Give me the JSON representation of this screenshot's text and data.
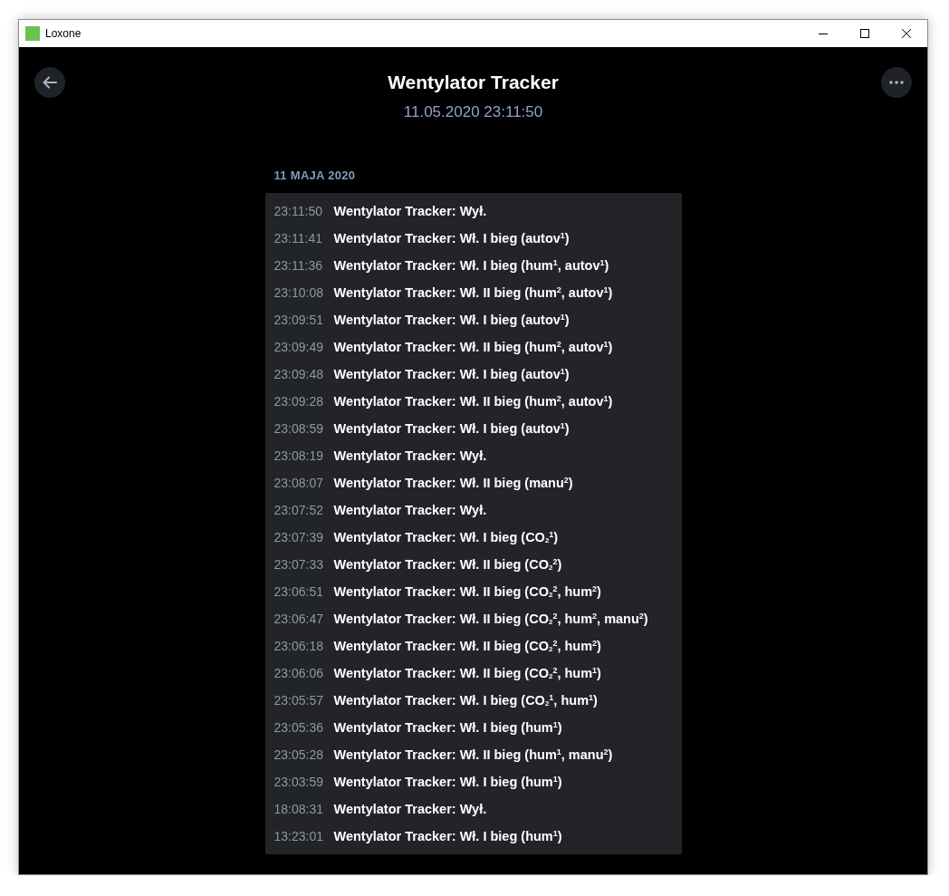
{
  "window": {
    "title": "Loxone"
  },
  "header": {
    "title": "Wentylator Tracker",
    "subtitle": "11.05.2020 23:11:50"
  },
  "date_label": "11 MAJA 2020",
  "entries": [
    {
      "time": "23:11:50",
      "text": "Wentylator Tracker: Wył."
    },
    {
      "time": "23:11:41",
      "text": "Wentylator Tracker: Wł. I bieg (autov$^{1}$)"
    },
    {
      "time": "23:11:36",
      "text": "Wentylator Tracker: Wł. I bieg (hum$^{1}$, autov$^{1}$)"
    },
    {
      "time": "23:10:08",
      "text": "Wentylator Tracker: Wł. II bieg (hum$^{2}$, autov$^{1}$)"
    },
    {
      "time": "23:09:51",
      "text": "Wentylator Tracker: Wł. I bieg (autov$^{1}$)"
    },
    {
      "time": "23:09:49",
      "text": "Wentylator Tracker: Wł. II bieg (hum$^{2}$, autov$^{1}$)"
    },
    {
      "time": "23:09:48",
      "text": "Wentylator Tracker: Wł. I bieg (autov$^{1}$)"
    },
    {
      "time": "23:09:28",
      "text": "Wentylator Tracker: Wł. II bieg (hum$^{2}$, autov$^{1}$)"
    },
    {
      "time": "23:08:59",
      "text": "Wentylator Tracker: Wł. I bieg (autov$^{1}$)"
    },
    {
      "time": "23:08:19",
      "text": "Wentylator Tracker: Wył."
    },
    {
      "time": "23:08:07",
      "text": "Wentylator Tracker: Wł. II bieg (manu$^{2}$)"
    },
    {
      "time": "23:07:52",
      "text": "Wentylator Tracker: Wył."
    },
    {
      "time": "23:07:39",
      "text": "Wentylator Tracker: Wł. I bieg (CO$_{2}$$^{1}$)"
    },
    {
      "time": "23:07:33",
      "text": "Wentylator Tracker: Wł. II bieg (CO$_{2}$$^{2}$)"
    },
    {
      "time": "23:06:51",
      "text": "Wentylator Tracker: Wł. II bieg (CO$_{2}$$^{2}$, hum$^{2}$)"
    },
    {
      "time": "23:06:47",
      "text": "Wentylator Tracker: Wł. II bieg (CO$_{2}$$^{2}$, hum$^{2}$, manu$^{2}$)"
    },
    {
      "time": "23:06:18",
      "text": "Wentylator Tracker: Wł. II bieg (CO$_{2}$$^{2}$, hum$^{2}$)"
    },
    {
      "time": "23:06:06",
      "text": "Wentylator Tracker: Wł. II bieg (CO$_{2}$$^{2}$, hum$^{1}$)"
    },
    {
      "time": "23:05:57",
      "text": "Wentylator Tracker: Wł. I bieg (CO$_{2}$$^{1}$, hum$^{1}$)"
    },
    {
      "time": "23:05:36",
      "text": "Wentylator Tracker: Wł. I bieg (hum$^{1}$)"
    },
    {
      "time": "23:05:28",
      "text": "Wentylator Tracker: Wł. II bieg (hum$^{1}$, manu$^{2}$)"
    },
    {
      "time": "23:03:59",
      "text": "Wentylator Tracker: Wł. I bieg (hum$^{1}$)"
    },
    {
      "time": "18:08:31",
      "text": "Wentylator Tracker: Wył."
    },
    {
      "time": "13:23:01",
      "text": "Wentylator Tracker: Wł. I bieg (hum$^{1}$)"
    }
  ]
}
